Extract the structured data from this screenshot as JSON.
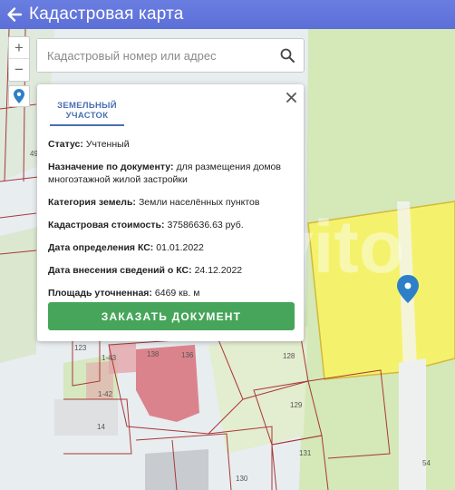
{
  "header": {
    "title": "Кадастровая карта",
    "back_icon": "arrow-left-icon"
  },
  "search": {
    "placeholder": "Кадастровый номер или адрес",
    "value": ""
  },
  "zoom": {
    "in": "+",
    "out": "−"
  },
  "card": {
    "tab_label": "ЗЕМЕЛЬНЫЙ УЧАСТОК",
    "fields": [
      {
        "key": "Статус:",
        "value": "Учтенный"
      },
      {
        "key": "Назначение по документу:",
        "value": "для размещения домов многоэтажной жилой застройки"
      },
      {
        "key": "Категория земель:",
        "value": "Земли населённых пунктов"
      },
      {
        "key": "Кадастровая стоимость:",
        "value": "37586636.63 руб."
      },
      {
        "key": "Дата определения КС:",
        "value": "01.01.2022"
      },
      {
        "key": "Дата внесения сведений о КС:",
        "value": "24.12.2022"
      },
      {
        "key": "Площадь уточненная:",
        "value": "6469 кв. м"
      }
    ],
    "order_button": "ЗАКАЗАТЬ ДОКУМЕНТ"
  },
  "map_labels": {
    "l49": "49",
    "l123": "123",
    "l143": "1-43",
    "l142": "1-42",
    "l138": "138",
    "l136": "136",
    "l14": "14",
    "l128": "128",
    "l129": "129",
    "l131": "131",
    "l130": "130",
    "l54": "54"
  },
  "colors": {
    "header": "#5b6fd8",
    "selected_parcel": "#f5f26a",
    "button": "#46a55a",
    "tab": "#4a6fb3"
  }
}
